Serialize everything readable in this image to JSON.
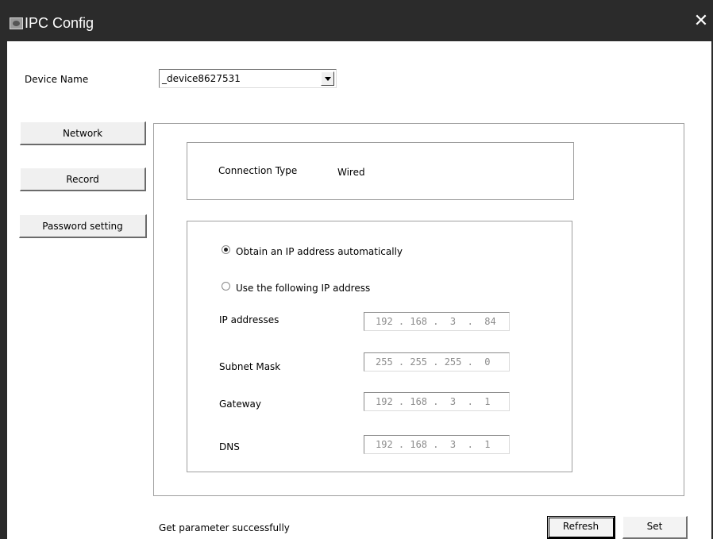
{
  "window": {
    "title": "IPC Config",
    "close_glyph": "✕"
  },
  "device": {
    "label": "Device Name",
    "selected": "_device8627531"
  },
  "sidebar": {
    "items": [
      {
        "label": "Network"
      },
      {
        "label": "Record"
      },
      {
        "label": "Password setting"
      }
    ]
  },
  "connection": {
    "label": "Connection Type",
    "value": "Wired"
  },
  "ip_mode": {
    "auto_label": "Obtain an IP address automatically",
    "manual_label": "Use the following IP address",
    "selected": "auto"
  },
  "fields": [
    {
      "label": "IP addresses",
      "value": "192 . 168 .  3  .  84"
    },
    {
      "label": "Subnet Mask",
      "value": "255 . 255 . 255 .  0"
    },
    {
      "label": "Gateway",
      "value": "192 . 168 .  3  .  1"
    },
    {
      "label": "DNS",
      "value": "192 . 168 .  3  .  1"
    }
  ],
  "status": {
    "message": "Get parameter successfully"
  },
  "buttons": {
    "refresh": "Refresh",
    "set": "Set"
  },
  "icons": {
    "app": "camera-app-icon",
    "close": "close-icon",
    "dropdown": "chevron-down-icon"
  },
  "colors": {
    "titlebar": "#2b2b2b",
    "face": "#f0f0f0",
    "disabled_text": "#8c8c8c"
  }
}
